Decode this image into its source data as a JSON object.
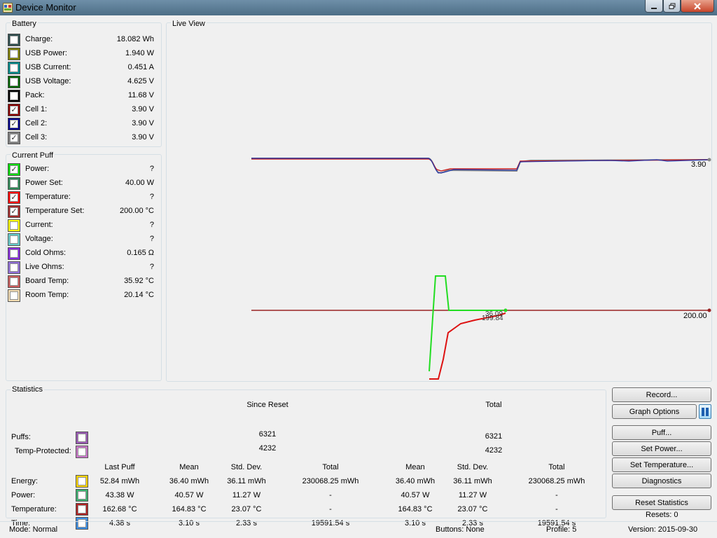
{
  "window": {
    "title": "Device Monitor"
  },
  "battery": {
    "title": "Battery",
    "items": [
      {
        "label": "Charge:",
        "value": "18.082 Wh",
        "color": "#2f4f4f",
        "checked": false
      },
      {
        "label": "USB Power:",
        "value": "1.940 W",
        "color": "#808000",
        "checked": false
      },
      {
        "label": "USB Current:",
        "value": "0.451 A",
        "color": "#008b8b",
        "checked": false
      },
      {
        "label": "USB Voltage:",
        "value": "4.625 V",
        "color": "#006400",
        "checked": false
      },
      {
        "label": "Pack:",
        "value": "11.68 V",
        "color": "#000000",
        "checked": false
      },
      {
        "label": "Cell 1:",
        "value": "3.90 V",
        "color": "#8b0000",
        "checked": true
      },
      {
        "label": "Cell 2:",
        "value": "3.90 V",
        "color": "#00008b",
        "checked": true
      },
      {
        "label": "Cell 3:",
        "value": "3.90 V",
        "color": "#808080",
        "checked": true
      }
    ]
  },
  "current_puff": {
    "title": "Current Puff",
    "items": [
      {
        "label": "Power:",
        "value": "?",
        "color": "#00e000",
        "checked": true
      },
      {
        "label": "Power Set:",
        "value": "40.00 W",
        "color": "#2e8b57",
        "checked": false
      },
      {
        "label": "Temperature:",
        "value": "?",
        "color": "#ff0000",
        "checked": true
      },
      {
        "label": "Temperature Set:",
        "value": "200.00 °C",
        "color": "#a52a2a",
        "checked": true
      },
      {
        "label": "Current:",
        "value": "?",
        "color": "#ffff00",
        "checked": false
      },
      {
        "label": "Voltage:",
        "value": "?",
        "color": "#66cdcc",
        "checked": false
      },
      {
        "label": "Cold Ohms:",
        "value": "0.165 Ω",
        "color": "#8a2be2",
        "checked": false
      },
      {
        "label": "Live Ohms:",
        "value": "?",
        "color": "#9370db",
        "checked": false
      },
      {
        "label": "Board Temp:",
        "value": "35.92 °C",
        "color": "#cd5c5c",
        "checked": false
      },
      {
        "label": "Room Temp:",
        "value": "20.14 °C",
        "color": "#f5deb3",
        "checked": false
      }
    ]
  },
  "live_view": {
    "title": "Live View",
    "upper_label": "3.90",
    "lower_label": "200.00",
    "overlap_label_a": "36.09",
    "overlap_label_b": "199.84",
    "colors": {
      "cell1": "#cc2222",
      "cell2": "#2233aa",
      "cell3": "#888888",
      "power": "#22dd22",
      "temperature": "#dd1111",
      "temp_set": "#992222"
    }
  },
  "statistics": {
    "title": "Statistics",
    "since_reset": "Since Reset",
    "total": "Total",
    "counts": [
      {
        "label": "Puffs:",
        "color": "#9b59b6",
        "since_reset": "6321",
        "total": "6321"
      },
      {
        "label": "Temp-Protected:",
        "color": "#cc77cc",
        "since_reset": "4232",
        "total": "4232"
      }
    ],
    "headers": [
      "Last Puff",
      "Mean",
      "Std. Dev.",
      "Total",
      "Mean",
      "Std. Dev.",
      "Total"
    ],
    "rows": [
      {
        "label": "Energy:",
        "color": "#ffd700",
        "values": [
          "52.84 mWh",
          "36.40 mWh",
          "36.11 mWh",
          "230068.25 mWh",
          "36.40 mWh",
          "36.11 mWh",
          "230068.25 mWh"
        ]
      },
      {
        "label": "Power:",
        "color": "#3cb371",
        "values": [
          "43.38 W",
          "40.57 W",
          "11.27 W",
          "-",
          "40.57 W",
          "11.27 W",
          "-"
        ]
      },
      {
        "label": "Temperature:",
        "color": "#b22222",
        "values": [
          "162.68 °C",
          "164.83 °C",
          "23.07 °C",
          "-",
          "164.83 °C",
          "23.07 °C",
          "-"
        ]
      },
      {
        "label": "Time:",
        "color": "#3a8ee6",
        "values": [
          "4.38 s",
          "3.10 s",
          "2.33 s",
          "19591.54 s",
          "3.10 s",
          "2.33 s",
          "19591.54 s"
        ]
      }
    ]
  },
  "buttons": {
    "record": "Record...",
    "graph_options": "Graph Options",
    "puff": "Puff...",
    "set_power": "Set Power...",
    "set_temperature": "Set Temperature...",
    "diagnostics": "Diagnostics",
    "reset_statistics": "Reset Statistics"
  },
  "resets": "Resets: 0",
  "status": {
    "mode": "Mode: Normal",
    "buttons": "Buttons: None",
    "profile": "Profile: 5",
    "version": "Version: 2015-09-30"
  }
}
